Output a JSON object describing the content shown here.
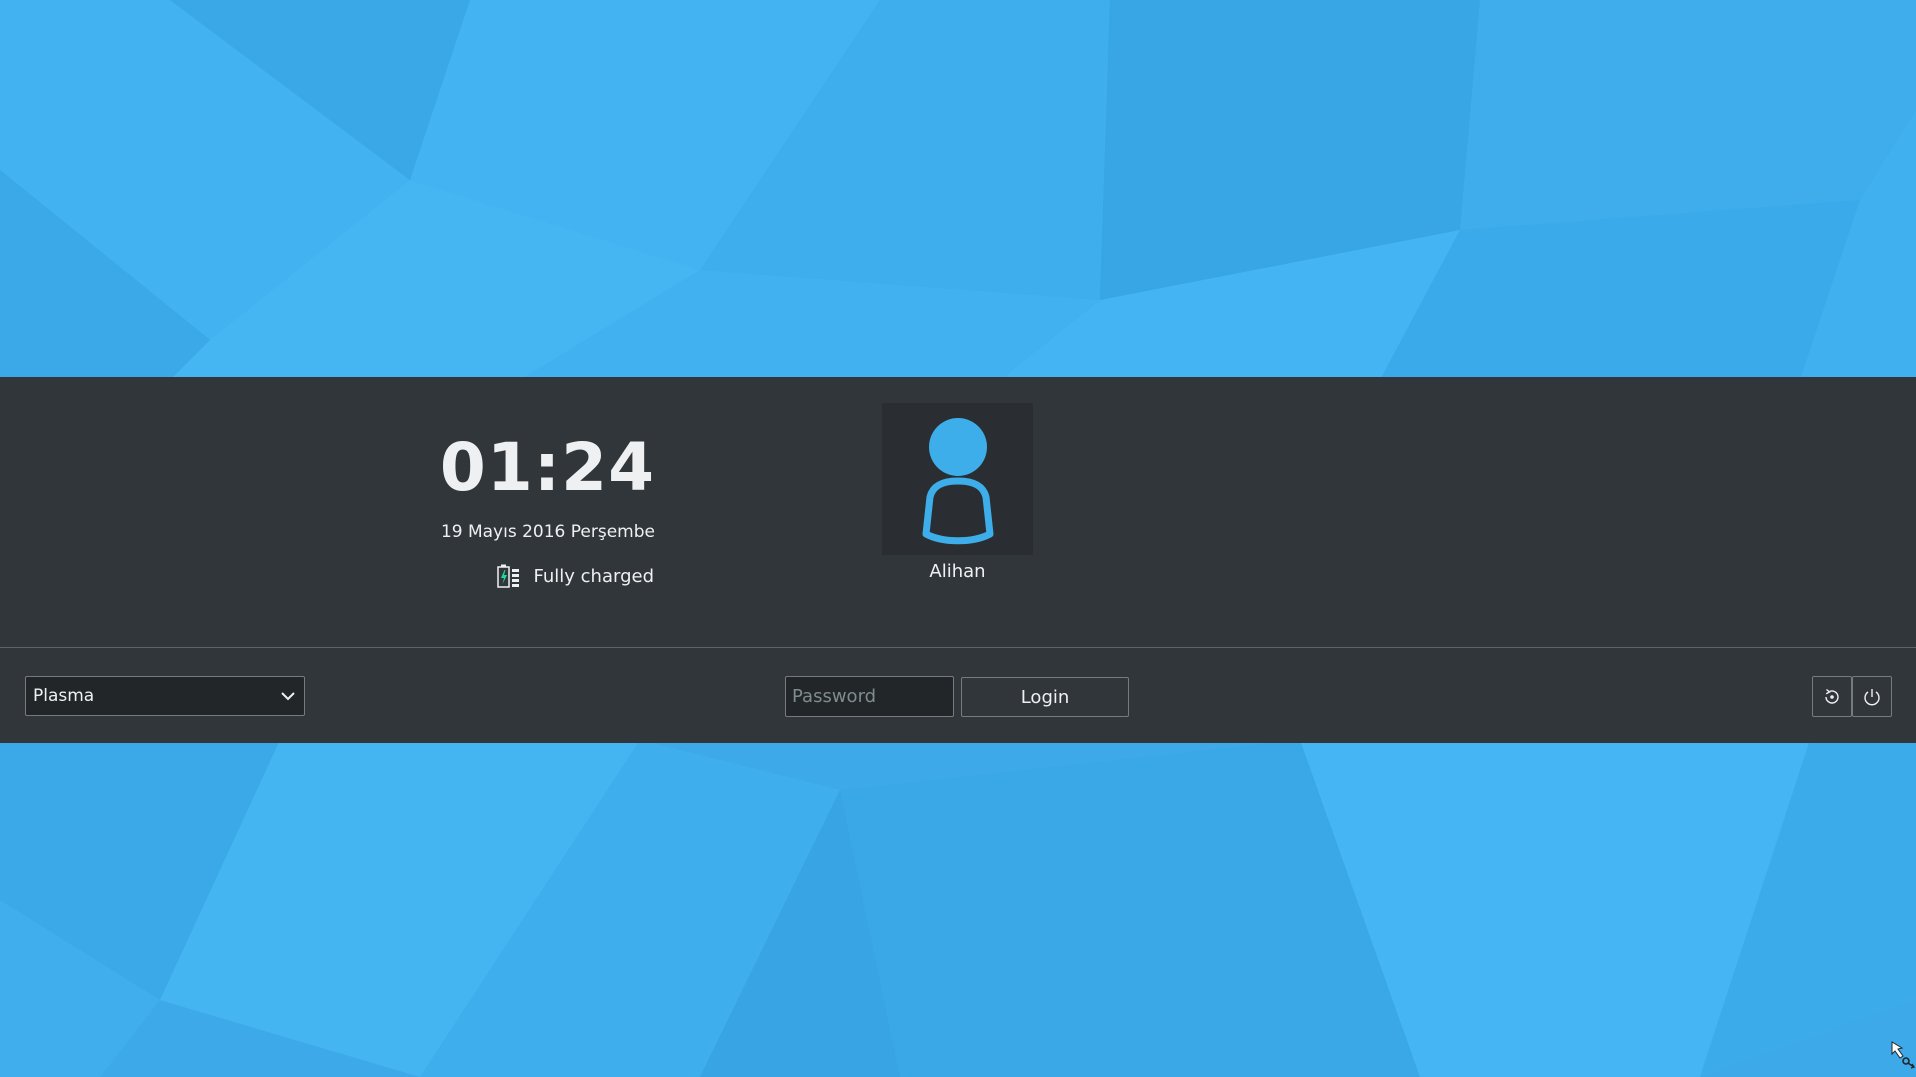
{
  "clock": {
    "time": "01:24",
    "date": "19 Mayıs 2016 Perşembe"
  },
  "battery": {
    "status": "Fully charged",
    "icon": "battery-charging-icon"
  },
  "user": {
    "name": "Alihan",
    "avatar_icon": "user-avatar-icon"
  },
  "session": {
    "selected": "Plasma",
    "icon": "chevron-down-icon"
  },
  "login": {
    "password_placeholder": "Password",
    "password_value": "",
    "button_label": "Login"
  },
  "actions": [
    {
      "name": "reboot",
      "icon": "reboot-icon"
    },
    {
      "name": "shutdown",
      "icon": "power-icon"
    }
  ],
  "colors": {
    "wallpaper": "#3daee9",
    "panel": "#31363b",
    "avatar_bg": "#2a2e32",
    "accent": "#3daee9",
    "text": "#eff0f1"
  }
}
